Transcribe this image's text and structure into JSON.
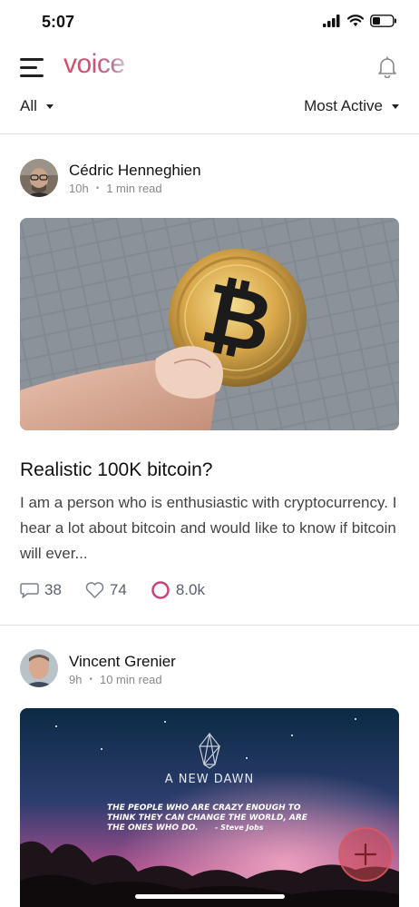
{
  "status_bar": {
    "time": "5:07"
  },
  "header": {
    "logo_text": "voice"
  },
  "filters": {
    "left_label": "All",
    "right_label": "Most Active"
  },
  "posts": [
    {
      "author": "Cédric Henneghien",
      "time_ago": "10h",
      "read_time": "1 min read",
      "title": "Realistic 100K bitcoin?",
      "excerpt": "I am a person who is enthusiastic with cryptocurrency. I hear a lot about bitcoin and would like to know if bitcoin will ever...",
      "comments": "38",
      "likes": "74",
      "views": "8.0k"
    },
    {
      "author": "Vincent Grenier",
      "time_ago": "9h",
      "read_time": "10 min read",
      "image_heading": "A NEW DAWN",
      "image_quote": "THE PEOPLE WHO ARE CRAZY ENOUGH TO THINK THEY CAN CHANGE THE WORLD, ARE THE ONES WHO DO.",
      "image_quote_author": "- Steve Jobs"
    }
  ],
  "colors": {
    "accent": "#d94c67",
    "views_ring": "#c7417a",
    "fab": "#cd4652"
  },
  "icons": [
    "signal-icon",
    "wifi-icon",
    "battery-icon",
    "menu-icon",
    "bell-icon",
    "comment-icon",
    "heart-icon",
    "views-ring-icon",
    "plus-icon",
    "eos-logo-icon"
  ]
}
